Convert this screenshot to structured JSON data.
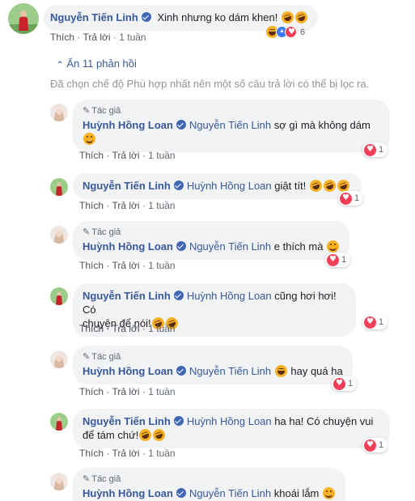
{
  "top_comment": {
    "author": "Nguyễn Tiến Linh",
    "text": "Xinh nhưng ko dám khen!",
    "actions": {
      "like": "Thích",
      "reply": "Trả lời",
      "time": "1 tuần"
    },
    "reaction_count": "6"
  },
  "replies_toggle": {
    "label": "Ẩn 11 phản hồi"
  },
  "filter_note": "Đã chọn chế độ Phù hợp nhất nên một số câu trả lời có thể bị lọc ra.",
  "author_tag": "Tác giả",
  "actions": {
    "like": "Thích",
    "reply": "Trả lời",
    "time": "1 tuần"
  },
  "replies": [
    {
      "author": "Huỳnh Hồng Loan",
      "mention": "Nguyễn Tiến Linh",
      "text_line1": "sợ gì mà không dám",
      "text_line2": "",
      "reactions": "1"
    },
    {
      "author": "Nguyễn Tiến Linh",
      "mention": "Huỳnh Hồng Loan",
      "text_line1": "giật tít!",
      "text_line2": "",
      "reactions": "1"
    },
    {
      "author": "Huỳnh Hồng Loan",
      "mention": "Nguyễn Tiến Linh",
      "text_line1": "e thích mà",
      "text_line2": "",
      "reactions": "1"
    },
    {
      "author": "Nguyễn Tiến Linh",
      "mention": "Huỳnh Hồng Loan",
      "text_line1": "cũng hơi hơi! Có",
      "text_line2": "chuyện để nói!",
      "reactions": "1"
    },
    {
      "author": "Huỳnh Hồng Loan",
      "mention": "Nguyễn Tiến Linh",
      "text_line1": "hay quá ha",
      "text_line2": "",
      "reactions": "1"
    },
    {
      "author": "Nguyễn Tiến Linh",
      "mention": "Huỳnh Hồng Loan",
      "text_line1": "ha ha! Có chuyện vui",
      "text_line2": "để tám chứ!",
      "reactions": "1"
    },
    {
      "author": "Huỳnh Hồng Loan",
      "mention": "Nguyễn Tiến Linh",
      "text_line1": "khoái lắm",
      "text_line2": "",
      "reactions": ""
    }
  ]
}
